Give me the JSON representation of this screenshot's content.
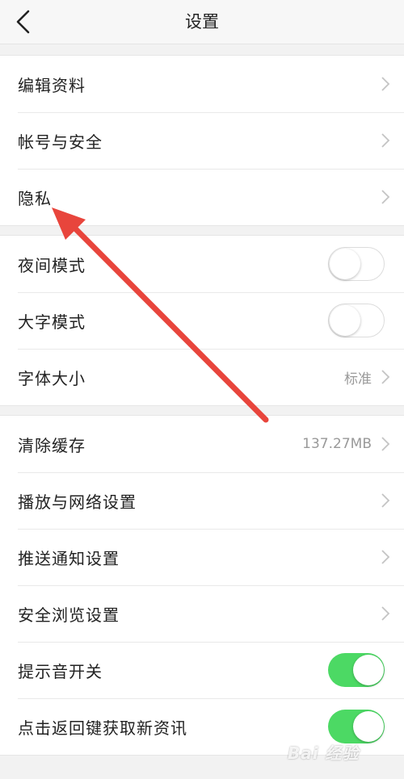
{
  "header": {
    "title": "设置"
  },
  "group1": [
    {
      "label": "编辑资料"
    },
    {
      "label": "帐号与安全"
    },
    {
      "label": "隐私"
    }
  ],
  "group2": {
    "night_mode": {
      "label": "夜间模式",
      "on": false
    },
    "large_text": {
      "label": "大字模式",
      "on": false
    },
    "font_size": {
      "label": "字体大小",
      "value": "标准"
    }
  },
  "group3": {
    "clear_cache": {
      "label": "清除缓存",
      "value": "137.27MB"
    },
    "playback_network": {
      "label": "播放与网络设置"
    },
    "push_notifications": {
      "label": "推送通知设置"
    },
    "safe_browsing": {
      "label": "安全浏览设置"
    },
    "sound_toggle": {
      "label": "提示音开关",
      "on": true
    },
    "back_refresh": {
      "label": "点击返回键获取新资讯",
      "on": true
    }
  },
  "watermark": "Bai 经验",
  "colors": {
    "toggle_on": "#4cd964",
    "annotation_arrow": "#e8453c"
  }
}
